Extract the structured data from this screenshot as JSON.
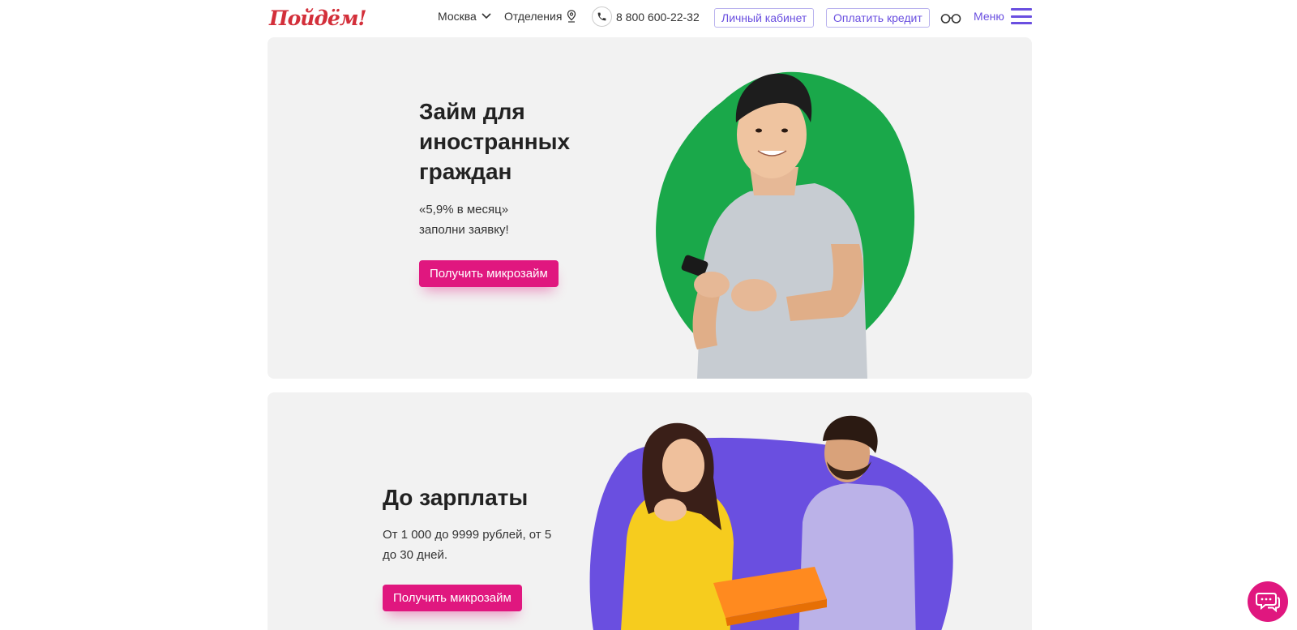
{
  "header": {
    "logo_text": "Пойдём!",
    "city": "Москва",
    "branches": "Отделения",
    "phone": "8 800 600-22-32",
    "cabinet_button": "Личный кабинет",
    "pay_button": "Оплатить кредит",
    "menu_label": "Меню"
  },
  "cards": [
    {
      "title_line1": "Займ для",
      "title_line2": "иностранных",
      "title_line3": "граждан",
      "text_line1": "«5,9% в месяц»",
      "text_line2": "заполни заявку!",
      "button": "Получить микрозайм",
      "blob_color": "#1aa84a"
    },
    {
      "title": "До зарплаты",
      "text_line1": "От 1 000 до 9999 рублей, от 5",
      "text_line2": "до 30 дней.",
      "button": "Получить микрозайм",
      "blob_color": "#6a4fe0"
    }
  ],
  "colors": {
    "accent_pink": "#e0177f",
    "accent_purple": "#6a4fe0",
    "logo_red": "#d32f3a",
    "card_bg": "#f2f2f2"
  },
  "icons": [
    "chevron-down-icon",
    "map-pin-icon",
    "phone-icon",
    "glasses-icon",
    "burger-menu-icon",
    "chat-icon"
  ]
}
